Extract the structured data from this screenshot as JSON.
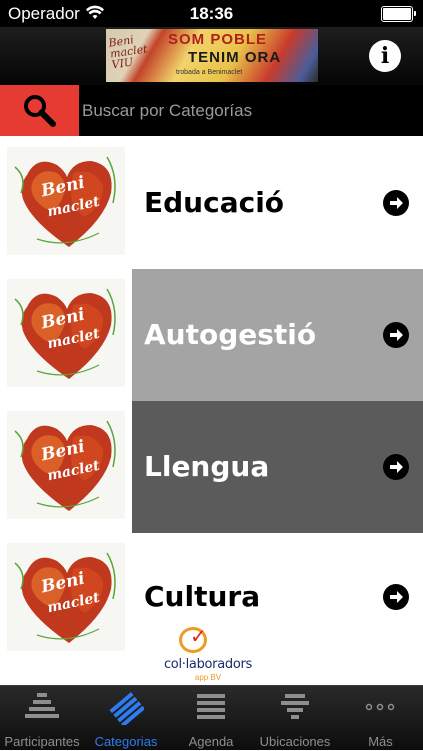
{
  "status_bar": {
    "carrier": "Operador",
    "time": "18:36"
  },
  "header": {
    "banner": {
      "line1": "Beni\nmaclet\nVIU",
      "line2": "SOM POBLE",
      "line3": "TENIM ORA",
      "line4": "trobada a Benimaclet"
    },
    "info_label": "i"
  },
  "search": {
    "placeholder": "Buscar por Categorías"
  },
  "categories": [
    {
      "label": "Educació",
      "bg": "#ffffff",
      "text_color": "#000000"
    },
    {
      "label": "Autogestió",
      "bg": "#a4a4a4",
      "text_color": "#ffffff"
    },
    {
      "label": "Llengua",
      "bg": "#5b5b5b",
      "text_color": "#ffffff"
    },
    {
      "label": "Cultura",
      "bg": "#ffffff",
      "text_color": "#000000"
    }
  ],
  "thumbnail_text": [
    "Beni",
    "maclet"
  ],
  "collaborators": {
    "label": "col·laboradors",
    "sublabel": "app BV"
  },
  "tabs": [
    {
      "label": "Participantes",
      "icon": "participants-icon",
      "active": false
    },
    {
      "label": "Categorias",
      "icon": "categories-icon",
      "active": true
    },
    {
      "label": "Agenda",
      "icon": "agenda-icon",
      "active": false
    },
    {
      "label": "Ubicaciones",
      "icon": "locations-icon",
      "active": false
    },
    {
      "label": "Más",
      "icon": "more-icon",
      "active": false
    }
  ],
  "colors": {
    "accent_red": "#e63b33",
    "tab_active": "#2d7cf0",
    "tab_inactive": "#8e8e8e"
  }
}
